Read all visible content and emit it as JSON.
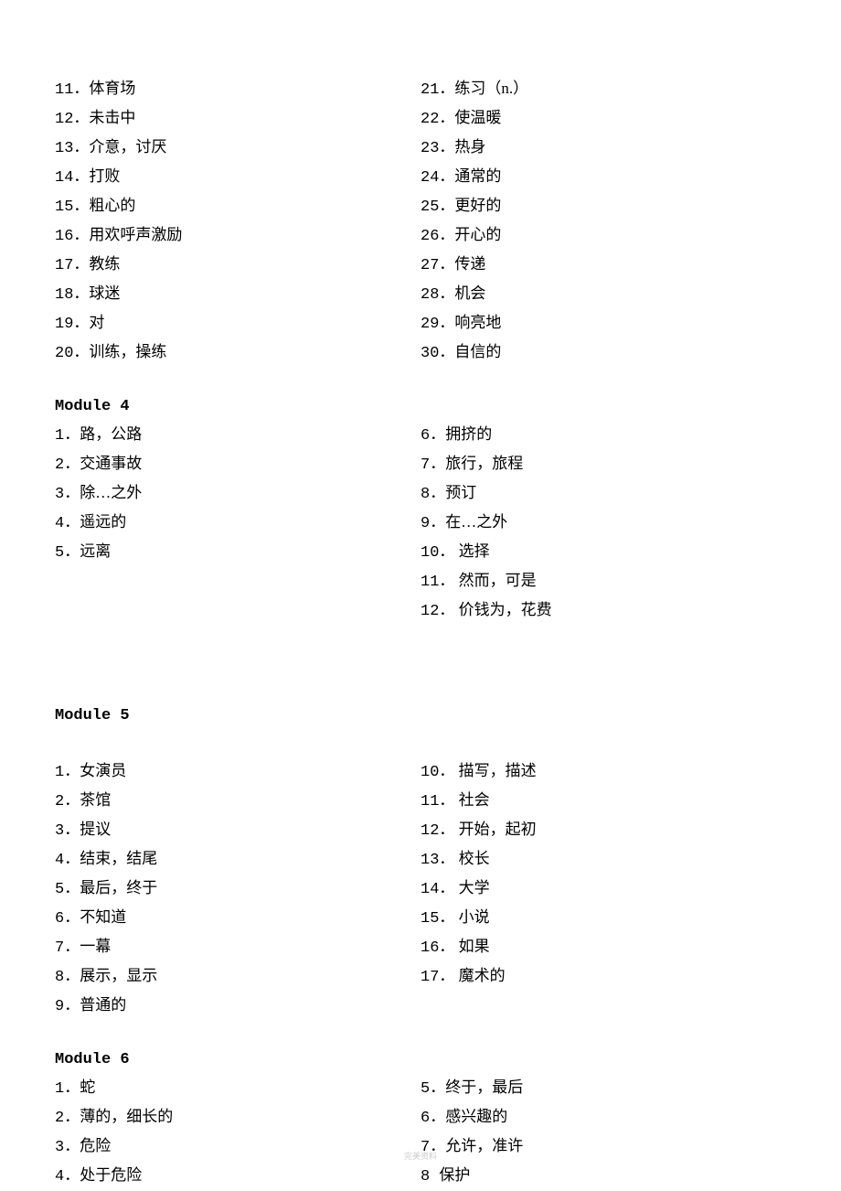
{
  "section1": {
    "left": [
      {
        "n": "11．",
        "t": "体育场"
      },
      {
        "n": "12．",
        "t": "未击中"
      },
      {
        "n": "13．",
        "t": "介意，讨厌"
      },
      {
        "n": "14．",
        "t": "打败"
      },
      {
        "n": "15．",
        "t": "粗心的"
      },
      {
        "n": "16．",
        "t": "用欢呼声激励"
      },
      {
        "n": "17．",
        "t": "教练"
      },
      {
        "n": "18．",
        "t": "球迷"
      },
      {
        "n": "19．",
        "t": "对"
      },
      {
        "n": "20．",
        "t": "训练，操练"
      }
    ],
    "right": [
      {
        "n": "21．",
        "t": "练习（n.）"
      },
      {
        "n": "22．",
        "t": "使温暖"
      },
      {
        "n": "23．",
        "t": "热身"
      },
      {
        "n": "24．",
        "t": "通常的"
      },
      {
        "n": "25．",
        "t": "更好的"
      },
      {
        "n": "26．",
        "t": "开心的"
      },
      {
        "n": "27．",
        "t": "传递"
      },
      {
        "n": "28．",
        "t": "机会"
      },
      {
        "n": "29．",
        "t": "响亮地"
      },
      {
        "n": "30．",
        "t": "自信的"
      }
    ]
  },
  "module4": {
    "title": "Module  4",
    "left": [
      {
        "n": "1．",
        "t": "路，公路"
      },
      {
        "n": "2．",
        "t": "交通事故"
      },
      {
        "n": "3．",
        "t": "除…之外"
      },
      {
        "n": "4．",
        "t": "遥远的"
      },
      {
        "n": "5．",
        "t": "远离"
      }
    ],
    "right": [
      {
        "n": "6．",
        "t": "拥挤的"
      },
      {
        "n": "7．",
        "t": "旅行，旅程"
      },
      {
        "n": "8．",
        "t": "预订"
      },
      {
        "n": "9．",
        "t": "在…之外"
      },
      {
        "n": "10．",
        "t": " 选择"
      },
      {
        "n": "11．",
        "t": " 然而，可是"
      },
      {
        "n": "12．",
        "t": " 价钱为，花费"
      }
    ]
  },
  "module5": {
    "title": "Module  5",
    "left": [
      {
        "n": "1．",
        "t": "女演员"
      },
      {
        "n": "2．",
        "t": "茶馆"
      },
      {
        "n": "3．",
        "t": "提议"
      },
      {
        "n": "4．",
        "t": "结束，结尾"
      },
      {
        "n": "5．",
        "t": "最后，终于"
      },
      {
        "n": "6．",
        "t": "不知道"
      },
      {
        "n": "7．",
        "t": "一幕"
      },
      {
        "n": "8．",
        "t": "展示，显示"
      },
      {
        "n": "9．",
        "t": "普通的"
      }
    ],
    "right": [
      {
        "n": "10．",
        "t": " 描写，描述"
      },
      {
        "n": "11．",
        "t": " 社会"
      },
      {
        "n": "12．",
        "t": " 开始，起初"
      },
      {
        "n": "13．",
        "t": " 校长"
      },
      {
        "n": "14．",
        "t": " 大学"
      },
      {
        "n": "15．",
        "t": " 小说"
      },
      {
        "n": "16．",
        "t": " 如果"
      },
      {
        "n": "17．",
        "t": " 魔术的"
      }
    ]
  },
  "module6": {
    "title": "Module  6",
    "left": [
      {
        "n": "1．",
        "t": "蛇"
      },
      {
        "n": "2．",
        "t": "薄的，细长的"
      },
      {
        "n": "3．",
        "t": "危险"
      },
      {
        "n": "4．",
        "t": "处于危险"
      }
    ],
    "right": [
      {
        "n": "5．",
        "t": "终于，最后"
      },
      {
        "n": "6．",
        "t": "感兴趣的"
      },
      {
        "n": "7．",
        "t": "允许，准许"
      },
      {
        "n": "8  ",
        "t": "保护"
      }
    ]
  },
  "footer": "完美资料"
}
